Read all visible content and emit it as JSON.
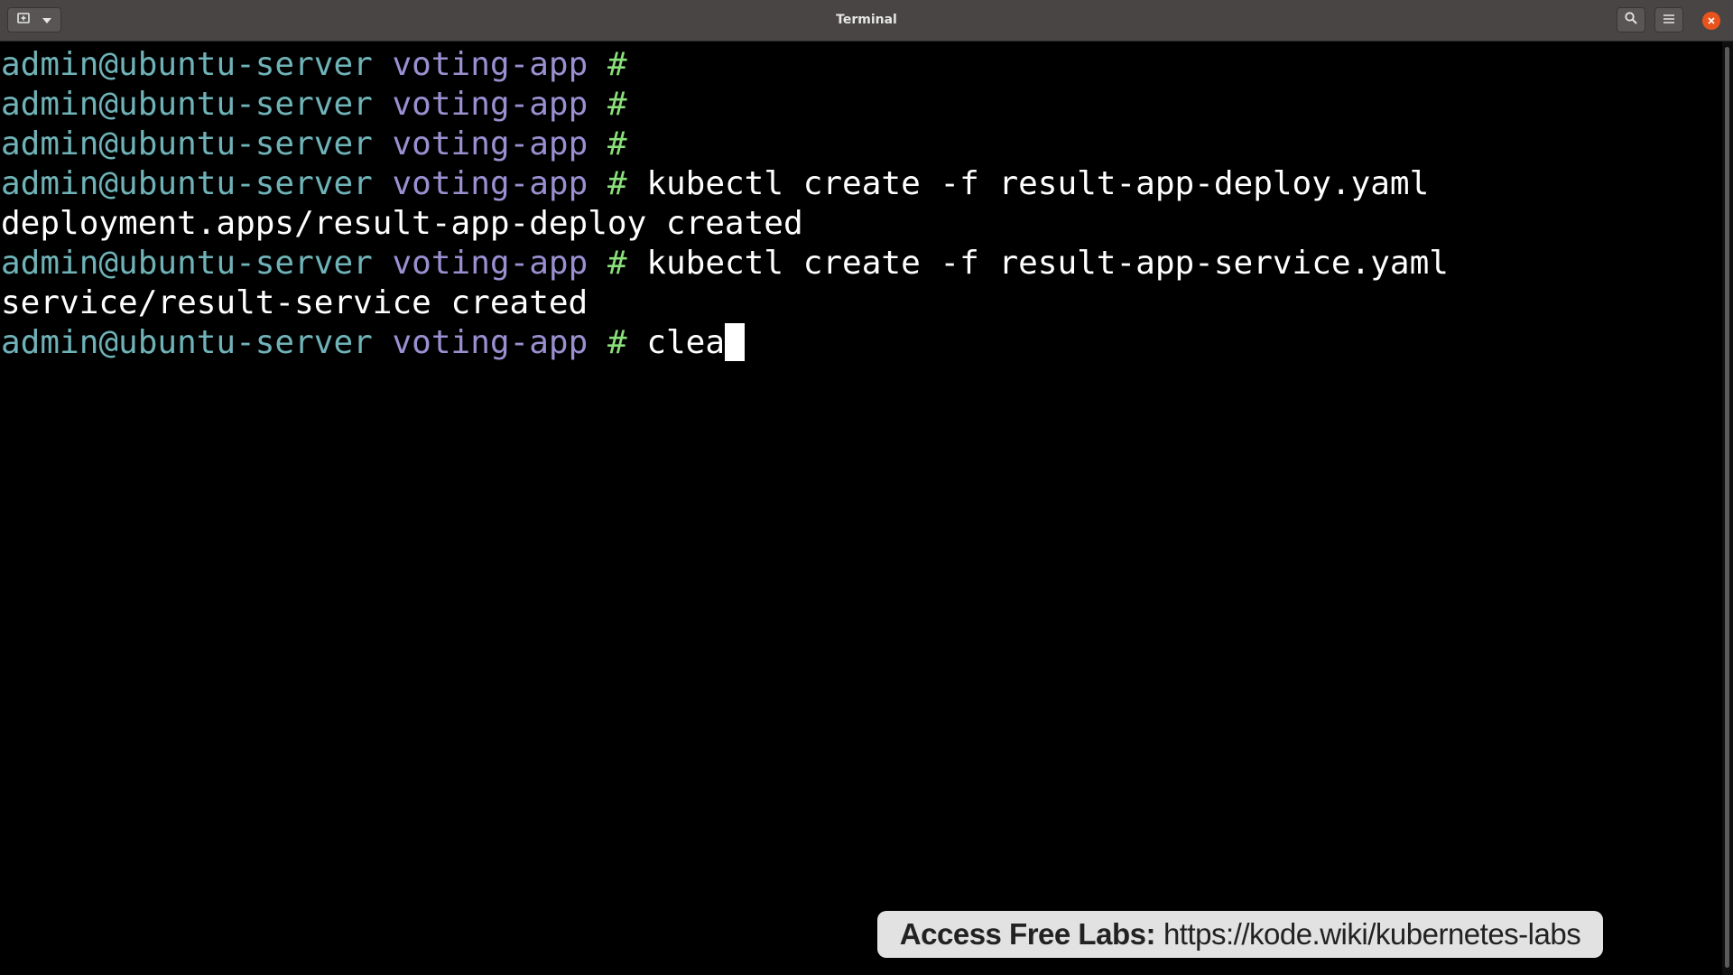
{
  "window": {
    "title": "Terminal"
  },
  "titlebar": {
    "new_tab_icon": "new-tab-icon",
    "dropdown_icon": "chevron-down-icon",
    "search_icon": "search-icon",
    "menu_icon": "hamburger-menu-icon",
    "close_icon": "close-icon"
  },
  "prompt": {
    "user_host": "admin@ubuntu-server",
    "directory": "voting-app",
    "symbol": "#"
  },
  "terminal": {
    "lines": [
      {
        "type": "prompt",
        "command": ""
      },
      {
        "type": "prompt",
        "command": ""
      },
      {
        "type": "prompt",
        "command": ""
      },
      {
        "type": "prompt",
        "command": "kubectl create -f result-app-deploy.yaml"
      },
      {
        "type": "output",
        "text": "deployment.apps/result-app-deploy created"
      },
      {
        "type": "prompt",
        "command": "kubectl create -f result-app-service.yaml"
      },
      {
        "type": "output",
        "text": "service/result-service created"
      },
      {
        "type": "prompt",
        "command": "clea",
        "cursor": true
      }
    ]
  },
  "banner": {
    "label": "Access Free Labs:",
    "url": "https://kode.wiki/kubernetes-labs"
  },
  "colors": {
    "titlebar": "#4a4545",
    "background": "#000000",
    "prompt_user": "#6fb3b8",
    "prompt_dir": "#9a8fd0",
    "prompt_hash": "#8ae07a",
    "close_button": "#e9541c",
    "banner_bg": "#e2e2e2"
  }
}
